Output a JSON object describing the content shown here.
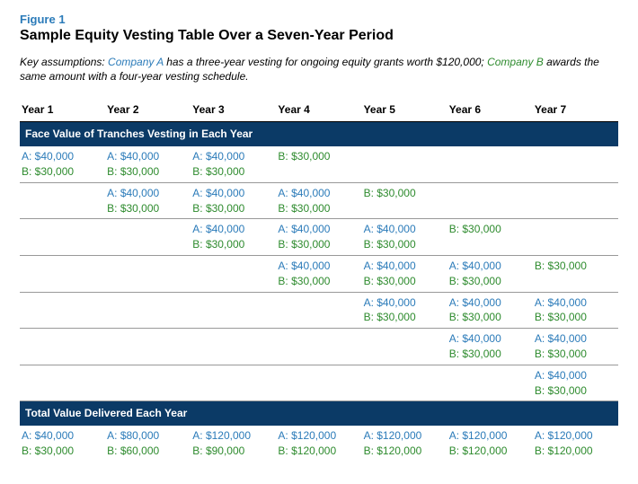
{
  "figure_label": "Figure 1",
  "figure_title": "Sample Equity Vesting Table Over a Seven-Year Period",
  "assumptions": {
    "prefix": "Key assumptions: ",
    "company_a_name": "Company A",
    "mid_a": " has a three-year vesting for ongoing equity grants worth $120,000; ",
    "company_b_name": "Company B",
    "mid_b": " awards the same amount with a four-year vesting schedule."
  },
  "headers": [
    "Year 1",
    "Year 2",
    "Year 3",
    "Year 4",
    "Year 5",
    "Year 6",
    "Year 7"
  ],
  "section_face_value": "Face Value of Tranches Vesting in Each Year",
  "section_total": "Total Value Delivered Each Year",
  "a_label": "A:",
  "b_label": "B:",
  "a_amount": "$40,000",
  "b_amount": "$30,000",
  "tranche_rows": [
    {
      "a_cols": [
        0,
        1,
        2
      ],
      "b_cols": [
        0,
        1,
        2,
        3
      ]
    },
    {
      "a_cols": [
        1,
        2,
        3
      ],
      "b_cols": [
        1,
        2,
        3,
        4
      ]
    },
    {
      "a_cols": [
        2,
        3,
        4
      ],
      "b_cols": [
        2,
        3,
        4,
        5
      ]
    },
    {
      "a_cols": [
        3,
        4,
        5
      ],
      "b_cols": [
        3,
        4,
        5,
        6
      ]
    },
    {
      "a_cols": [
        4,
        5,
        6
      ],
      "b_cols": [
        4,
        5,
        6
      ]
    },
    {
      "a_cols": [
        5,
        6
      ],
      "b_cols": [
        5,
        6
      ]
    },
    {
      "a_cols": [
        6
      ],
      "b_cols": [
        6
      ]
    }
  ],
  "totals": {
    "a": [
      "$40,000",
      "$80,000",
      "$120,000",
      "$120,000",
      "$120,000",
      "$120,000",
      "$120,000"
    ],
    "b": [
      "$30,000",
      "$60,000",
      "$90,000",
      "$120,000",
      "$120,000",
      "$120,000",
      "$120,000"
    ]
  },
  "chart_data": {
    "type": "table",
    "title": "Sample Equity Vesting Table Over a Seven-Year Period",
    "years": [
      1,
      2,
      3,
      4,
      5,
      6,
      7
    ],
    "company_a_tranche": 40000,
    "company_b_tranche": 30000,
    "company_a_vesting_years": 3,
    "company_b_vesting_years": 4,
    "grant_face_value": 120000,
    "totals_company_a": [
      40000,
      80000,
      120000,
      120000,
      120000,
      120000,
      120000
    ],
    "totals_company_b": [
      30000,
      60000,
      90000,
      120000,
      120000,
      120000,
      120000
    ]
  }
}
